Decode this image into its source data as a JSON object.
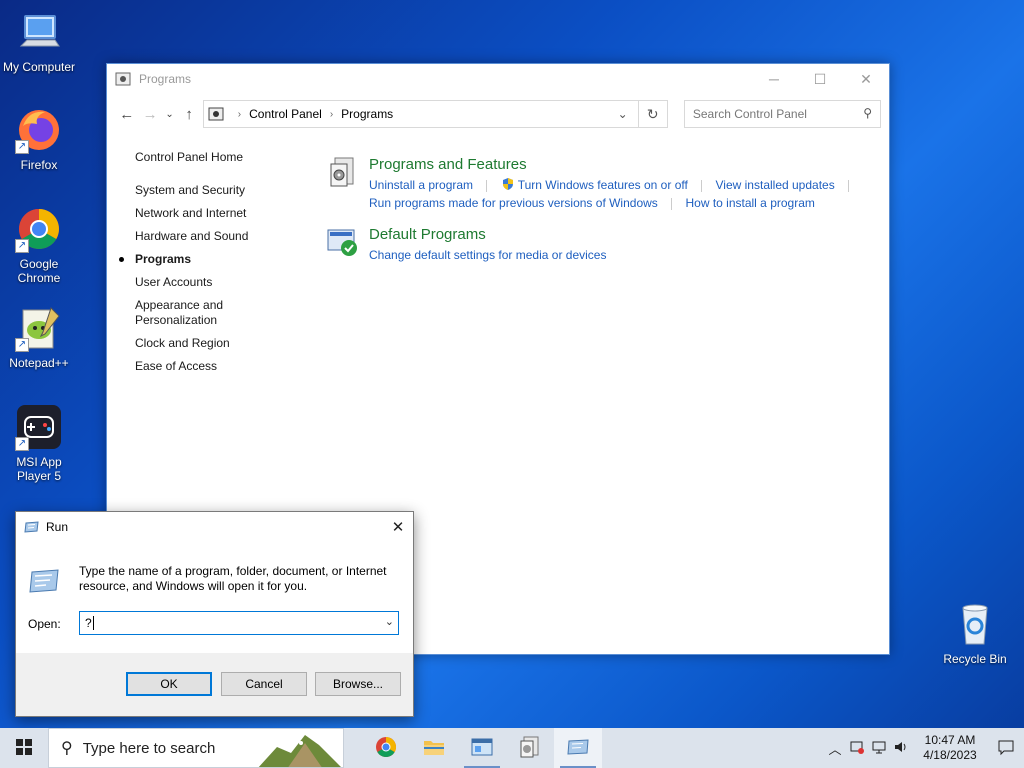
{
  "desktop": {
    "icons": [
      {
        "label": "My Computer"
      },
      {
        "label": "Firefox"
      },
      {
        "label": "Google Chrome"
      },
      {
        "label": "Notepad++"
      },
      {
        "label": "MSI App Player 5"
      }
    ],
    "recycle_bin": {
      "label": "Recycle Bin"
    }
  },
  "control_panel": {
    "title": "Programs",
    "breadcrumb": [
      "Control Panel",
      "Programs"
    ],
    "search_placeholder": "Search Control Panel",
    "sidebar": {
      "home": "Control Panel Home",
      "items": [
        "System and Security",
        "Network and Internet",
        "Hardware and Sound",
        "Programs",
        "User Accounts",
        "Appearance and Personalization",
        "Clock and Region",
        "Ease of Access"
      ],
      "active_index": 3
    },
    "categories": [
      {
        "title": "Programs and Features",
        "links": [
          "Uninstall a program",
          "Turn Windows features on or off",
          "View installed updates",
          "Run programs made for previous versions of Windows",
          "How to install a program"
        ]
      },
      {
        "title": "Default Programs",
        "links": [
          "Change default settings for media or devices"
        ]
      }
    ],
    "colors": {
      "category_title": "#1e7a31",
      "link": "#1f5fbf"
    }
  },
  "run_dialog": {
    "title": "Run",
    "description": "Type the name of a program, folder, document, or Internet resource, and Windows will open it for you.",
    "open_label": "Open:",
    "open_value": "?",
    "buttons": {
      "ok": "OK",
      "cancel": "Cancel",
      "browse": "Browse..."
    }
  },
  "taskbar": {
    "search_placeholder": "Type here to search",
    "clock": {
      "time": "10:47 AM",
      "date": "4/18/2023"
    }
  }
}
